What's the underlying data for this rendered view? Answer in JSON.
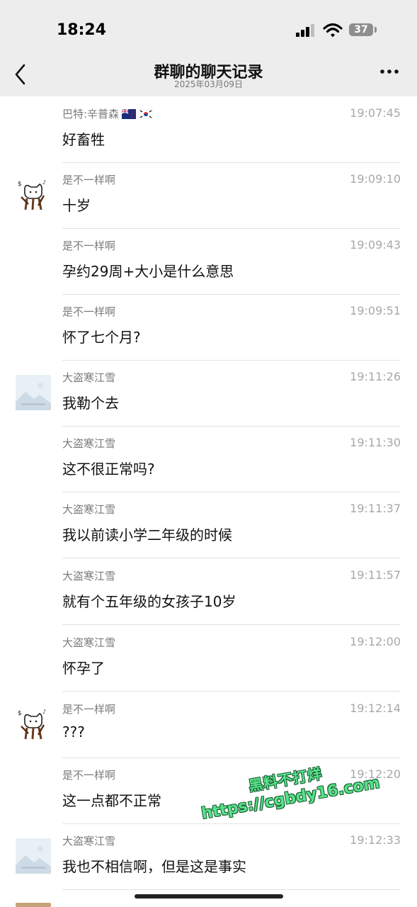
{
  "status_bar": {
    "time": "18:24",
    "battery": "37"
  },
  "header": {
    "title": "群聊的聊天记录",
    "date": "2025年03月09日"
  },
  "messages": [
    {
      "name": "巴特:辛普森",
      "flags": [
        "new-zealand-flag-icon",
        "south-korea-flag-icon"
      ],
      "time": "19:07:45",
      "text": "好畜牲",
      "avatar": "none"
    },
    {
      "name": "是不一样啊",
      "time": "19:09:10",
      "text": "十岁",
      "avatar": "cat-avatar"
    },
    {
      "name": "是不一样啊",
      "time": "19:09:43",
      "text": "孕约29周+大小是什么意思",
      "avatar": "none"
    },
    {
      "name": "是不一样啊",
      "time": "19:09:51",
      "text": "怀了七个月?",
      "avatar": "none"
    },
    {
      "name": "大盗寒江雪",
      "time": "19:11:26",
      "text": "我勒个去",
      "avatar": "landscape-avatar"
    },
    {
      "name": "大盗寒江雪",
      "time": "19:11:30",
      "text": "这不很正常吗?",
      "avatar": "none"
    },
    {
      "name": "大盗寒江雪",
      "time": "19:11:37",
      "text": "我以前读小学二年级的时候",
      "avatar": "none"
    },
    {
      "name": "大盗寒江雪",
      "time": "19:11:57",
      "text": "就有个五年级的女孩子10岁",
      "avatar": "none"
    },
    {
      "name": "大盗寒江雪",
      "time": "19:12:00",
      "text": "怀孕了",
      "avatar": "none"
    },
    {
      "name": "是不一样啊",
      "time": "19:12:14",
      "text": "???",
      "avatar": "cat-avatar"
    },
    {
      "name": "是不一样啊",
      "time": "19:12:20",
      "text": "这一点都不正常",
      "avatar": "none"
    },
    {
      "name": "大盗寒江雪",
      "time": "19:12:33",
      "text": "我也不相信啊，但是这是事实",
      "avatar": "landscape-avatar"
    }
  ],
  "watermark": {
    "line1": "黑料不打烊",
    "line2": "https://cgbdy16.com"
  },
  "colors": {
    "header_bg": "#ededed",
    "name": "#7a7a7a",
    "timestamp": "#a8a8a8",
    "divider": "#e3e3e3",
    "watermark": "#57e388"
  }
}
